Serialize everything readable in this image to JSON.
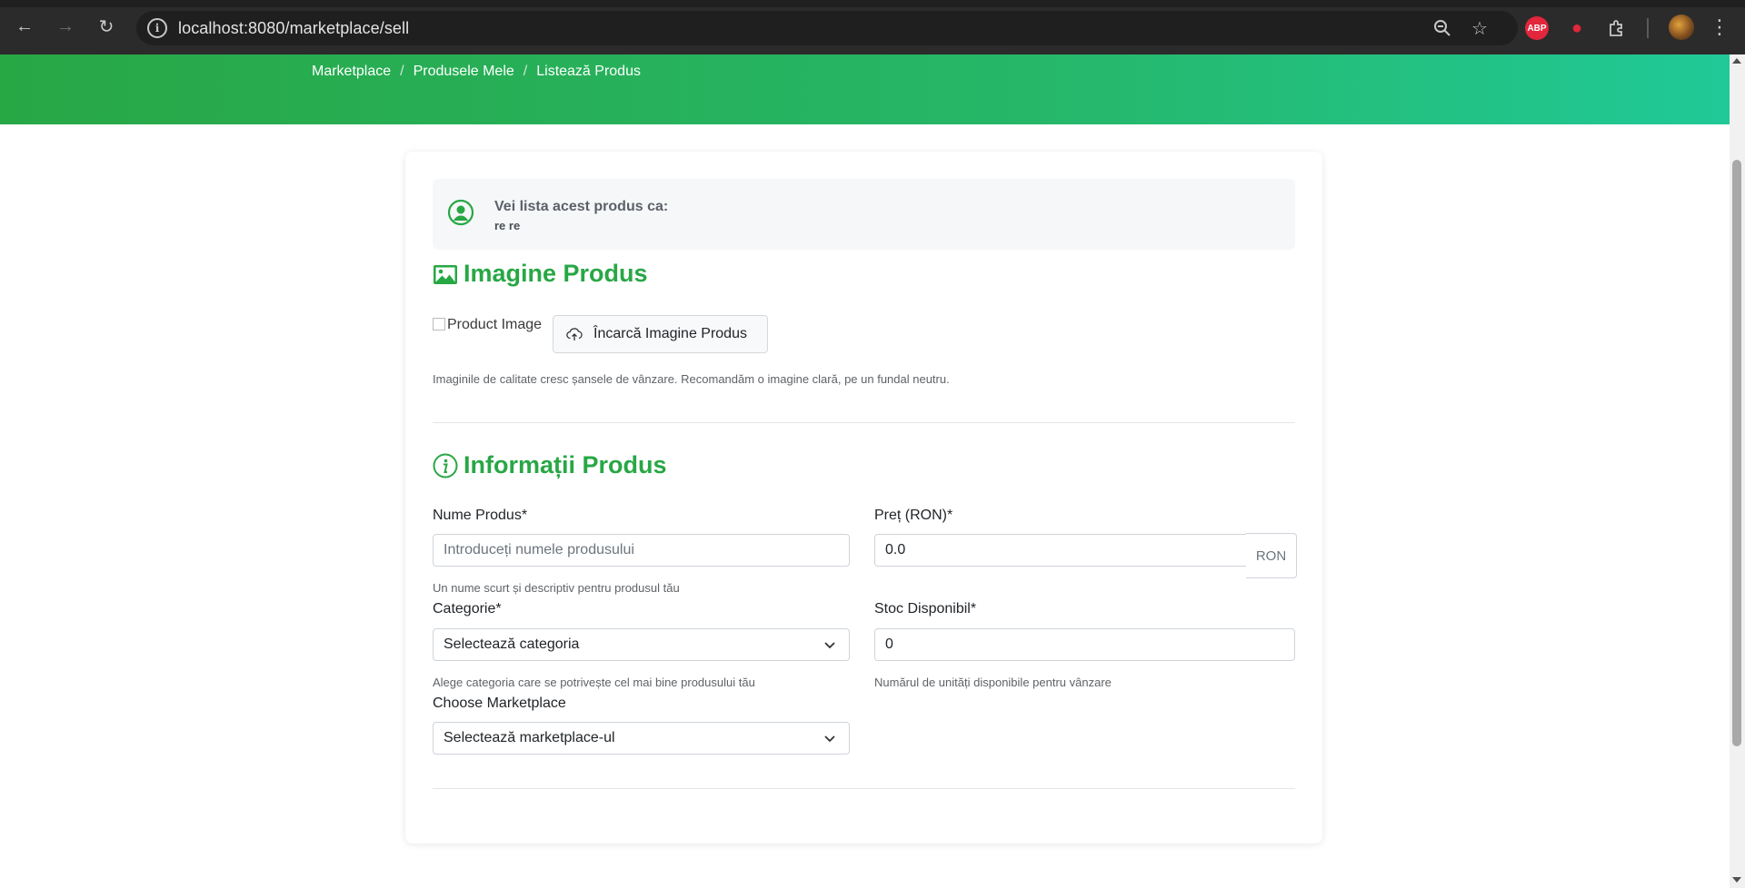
{
  "browser": {
    "url": "localhost:8080/marketplace/sell",
    "extensions": {
      "abp_label": "ABP"
    }
  },
  "breadcrumb": [
    "Marketplace",
    "Produsele Mele",
    "Listează Produs"
  ],
  "seller": {
    "title": "Vei lista acest produs ca:",
    "name": "re re"
  },
  "image_section": {
    "title": "Imagine Produs",
    "placeholder_alt": "Product Image",
    "upload_label": "Încarcă Imagine Produs",
    "hint": "Imaginile de calitate cresc șansele de vânzare. Recomandăm o imagine clară, pe un fundal neutru."
  },
  "info_section": {
    "title": "Informații Produs",
    "name": {
      "label": "Nume Produs*",
      "placeholder": "Introduceți numele produsului",
      "help": "Un nume scurt și descriptiv pentru produsul tău"
    },
    "price": {
      "label": "Preț (RON)*",
      "value": "0.0",
      "currency": "RON"
    },
    "category": {
      "label": "Categorie*",
      "selected": "Selectează categoria",
      "help": "Alege categoria care se potrivește cel mai bine produsului tău"
    },
    "stock": {
      "label": "Stoc Disponibil*",
      "value": "0",
      "help": "Numărul de unități disponibile pentru vânzare"
    },
    "marketplace": {
      "label": "Choose Marketplace",
      "selected": "Selectează marketplace-ul"
    }
  },
  "colors": {
    "accent": "#28a745",
    "header_gradient_end": "#20c997"
  }
}
